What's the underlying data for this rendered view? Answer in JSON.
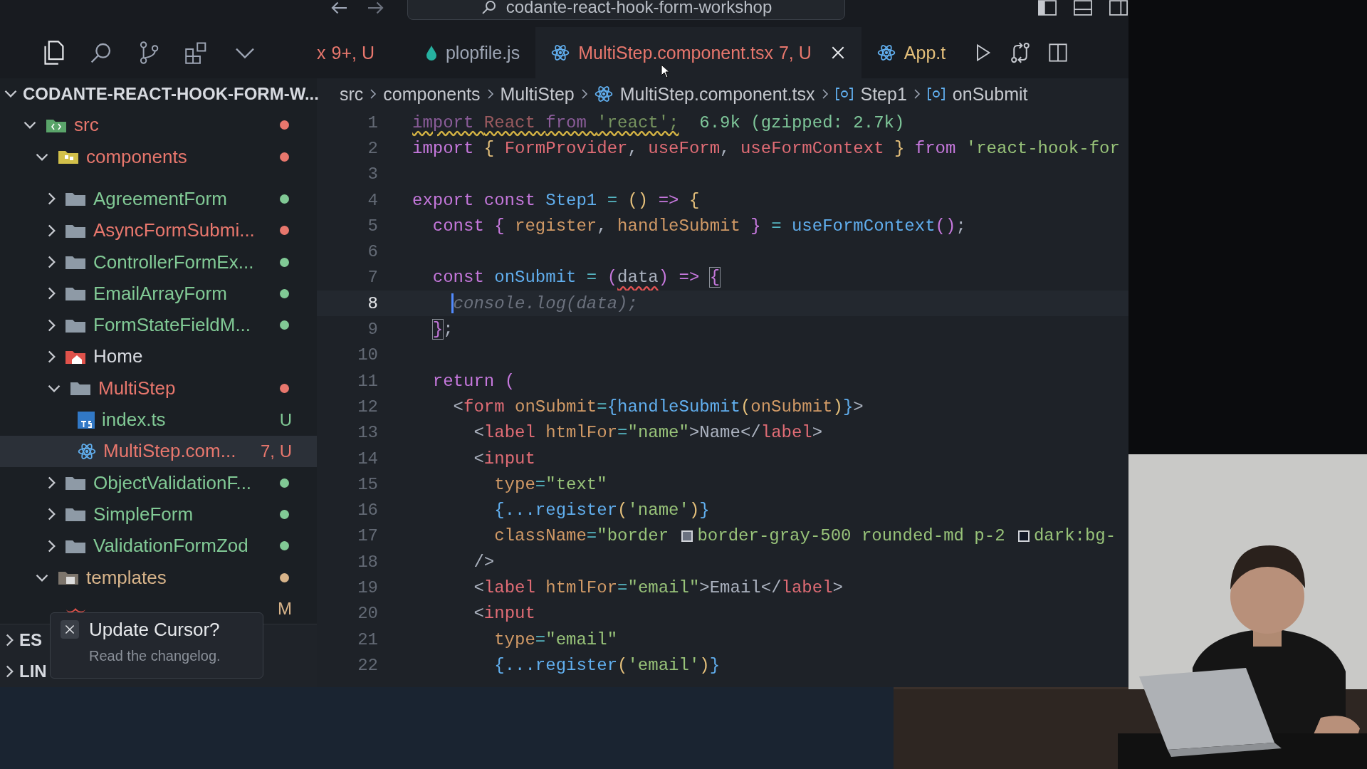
{
  "title_bar": {
    "search": "codante-react-hook-form-workshop"
  },
  "tabs": [
    {
      "label": "x",
      "badge": "9+, U",
      "kind": "plain",
      "selected": false,
      "color": "#e8776d"
    },
    {
      "label": "plopfile.js",
      "kind": "drop",
      "selected": false,
      "color": "#9da5b4"
    },
    {
      "label": "MultiStep.component.tsx",
      "badge": "7, U",
      "kind": "react",
      "selected": true,
      "color": "#e8776d"
    },
    {
      "label": "App.t",
      "kind": "react",
      "selected": false,
      "color": "#e5c07b"
    }
  ],
  "sidebar": {
    "title": "CODANTE-REACT-HOOK-FORM-W...",
    "items": [
      {
        "name": "src",
        "kind": "src-folder",
        "expanded": true,
        "color": "#e8776d",
        "dot": true,
        "selected": false,
        "children": [
          {
            "name": "components",
            "kind": "components-folder",
            "expanded": true,
            "color": "#e8776d",
            "dot": true,
            "selected": false,
            "children": [
              {
                "name": "AgreementForm",
                "kind": "folder",
                "expanded": false,
                "color": "#81c995",
                "dot": true,
                "selected": false
              },
              {
                "name": "AsyncFormSubmi...",
                "kind": "folder",
                "expanded": false,
                "color": "#e8776d",
                "dot": true,
                "selected": false
              },
              {
                "name": "ControllerFormEx...",
                "kind": "folder",
                "expanded": false,
                "color": "#81c995",
                "dot": true,
                "selected": false
              },
              {
                "name": "EmailArrayForm",
                "kind": "folder",
                "expanded": false,
                "color": "#81c995",
                "dot": true,
                "selected": false
              },
              {
                "name": "FormStateFieldM...",
                "kind": "folder",
                "expanded": false,
                "color": "#81c995",
                "dot": true,
                "selected": false
              },
              {
                "name": "Home",
                "kind": "home-folder",
                "expanded": false,
                "color": "#d7dae0",
                "dot": false,
                "selected": false
              },
              {
                "name": "MultiStep",
                "kind": "folder",
                "expanded": true,
                "color": "#e8776d",
                "dot": true,
                "selected": false,
                "children": [
                  {
                    "name": "index.ts",
                    "kind": "ts-file",
                    "color": "#81c995",
                    "badge": "U",
                    "dot": false,
                    "selected": false
                  },
                  {
                    "name": "MultiStep.com...",
                    "kind": "react-file",
                    "color": "#e8776d",
                    "badge": "7, U",
                    "dot": false,
                    "selected": true
                  }
                ]
              },
              {
                "name": "ObjectValidationF...",
                "kind": "folder",
                "expanded": false,
                "color": "#81c995",
                "dot": true,
                "selected": false
              },
              {
                "name": "SimpleForm",
                "kind": "folder",
                "expanded": false,
                "color": "#81c995",
                "dot": true,
                "selected": false
              },
              {
                "name": "ValidationFormZod",
                "kind": "folder",
                "expanded": false,
                "color": "#81c995",
                "dot": true,
                "selected": false
              }
            ]
          },
          {
            "name": "templates",
            "kind": "templates-folder",
            "expanded": true,
            "color": "#d8b48a",
            "dot": true,
            "selected": false,
            "children": [
              {
                "kind": "hbs-file",
                "color": "#d8b48a",
                "badge": "M",
                "dot": false,
                "selected": false
              }
            ]
          }
        ]
      }
    ],
    "sections": [
      {
        "label": "ES"
      },
      {
        "label": "LIN"
      }
    ]
  },
  "notification": {
    "title": "Update Cursor?",
    "body": "Read the changelog."
  },
  "breadcrumb": [
    {
      "label": "src",
      "kind": "folder"
    },
    {
      "label": "components",
      "kind": "folder"
    },
    {
      "label": "MultiStep",
      "kind": "folder"
    },
    {
      "label": "MultiStep.component.tsx",
      "kind": "react"
    },
    {
      "label": "Step1",
      "kind": "symbol"
    },
    {
      "label": "onSubmit",
      "kind": "symbol"
    }
  ],
  "code": [
    {
      "n": "1",
      "current": false,
      "tokens": [
        {
          "text": "import ",
          "kind": "kw-dim",
          "warning": true
        },
        {
          "text": "React ",
          "kind": "id-dim",
          "warning": true
        },
        {
          "text": "from ",
          "kind": "kw-dim",
          "warning": true
        },
        {
          "text": "'react';",
          "kind": "str-dim",
          "warning": true
        },
        {
          "text": "  6.9k (gzipped: 2.7k)",
          "kind": "hint"
        }
      ]
    },
    {
      "n": "2",
      "current": false,
      "tokens": [
        {
          "text": "import ",
          "kind": "kw"
        },
        {
          "text": "{",
          "kind": "br1"
        },
        {
          "text": " FormProvider",
          "kind": "id"
        },
        {
          "text": ", ",
          "kind": "p"
        },
        {
          "text": "useForm",
          "kind": "id"
        },
        {
          "text": ", ",
          "kind": "p"
        },
        {
          "text": "useFormContext",
          "kind": "id"
        },
        {
          "text": " }",
          "kind": "br1"
        },
        {
          "text": " from ",
          "kind": "kw"
        },
        {
          "text": "'react-hook-for",
          "kind": "str"
        }
      ]
    },
    {
      "n": "3",
      "current": false
    },
    {
      "n": "4",
      "current": false,
      "tokens": [
        {
          "text": "export const ",
          "kind": "kw"
        },
        {
          "text": "Step1",
          "kind": "fn"
        },
        {
          "text": " = ",
          "kind": "op"
        },
        {
          "text": "()",
          "kind": "br1"
        },
        {
          "text": " => ",
          "kind": "kw"
        },
        {
          "text": "{",
          "kind": "br1"
        }
      ]
    },
    {
      "n": "5",
      "current": false,
      "tokens": [
        {
          "text": "  const ",
          "kind": "kw"
        },
        {
          "text": "{ ",
          "kind": "br2"
        },
        {
          "text": "register",
          "kind": "attr"
        },
        {
          "text": ", ",
          "kind": "p"
        },
        {
          "text": "handleSubmit",
          "kind": "attr"
        },
        {
          "text": " }",
          "kind": "br2"
        },
        {
          "text": " = ",
          "kind": "op"
        },
        {
          "text": "useFormContext",
          "kind": "fn"
        },
        {
          "text": "()",
          "kind": "br2"
        },
        {
          "text": ";",
          "kind": "p"
        }
      ]
    },
    {
      "n": "6",
      "current": false
    },
    {
      "n": "7",
      "current": false,
      "tokens": [
        {
          "text": "  const ",
          "kind": "kw"
        },
        {
          "text": "onSubmit",
          "kind": "fn"
        },
        {
          "text": " = ",
          "kind": "op"
        },
        {
          "text": "(",
          "kind": "br2"
        },
        {
          "text": "data",
          "kind": "p",
          "error": true
        },
        {
          "text": ")",
          "kind": "br2"
        },
        {
          "text": " => ",
          "kind": "kw"
        },
        {
          "text": "{",
          "kind": "match"
        }
      ]
    },
    {
      "n": "8",
      "current": true,
      "tokens": [
        {
          "text": "    console.log(data);",
          "kind": "ghost"
        }
      ]
    },
    {
      "n": "9",
      "current": false,
      "tokens": [
        {
          "text": "  }",
          "kind": "match"
        },
        {
          "text": ";",
          "kind": "p"
        }
      ]
    },
    {
      "n": "10",
      "current": false
    },
    {
      "n": "11",
      "current": false,
      "tokens": [
        {
          "text": "  return ",
          "kind": "kw"
        },
        {
          "text": "(",
          "kind": "br2"
        }
      ]
    },
    {
      "n": "12",
      "current": false,
      "tokens": [
        {
          "text": "    <",
          "kind": "p"
        },
        {
          "text": "form",
          "kind": "tag"
        },
        {
          "text": " onSubmit",
          "kind": "attr"
        },
        {
          "text": "=",
          "kind": "op"
        },
        {
          "text": "{",
          "kind": "br3"
        },
        {
          "text": "handleSubmit",
          "kind": "fn"
        },
        {
          "text": "(",
          "kind": "br1"
        },
        {
          "text": "onSubmit",
          "kind": "attr"
        },
        {
          "text": ")",
          "kind": "br1"
        },
        {
          "text": "}",
          "kind": "br3"
        },
        {
          "text": ">",
          "kind": "p"
        }
      ]
    },
    {
      "n": "13",
      "current": false,
      "tokens": [
        {
          "text": "      <",
          "kind": "p"
        },
        {
          "text": "label",
          "kind": "tag"
        },
        {
          "text": " htmlFor",
          "kind": "attr"
        },
        {
          "text": "=",
          "kind": "op"
        },
        {
          "text": "\"name\"",
          "kind": "str"
        },
        {
          "text": ">Name</",
          "kind": "p"
        },
        {
          "text": "label",
          "kind": "tag"
        },
        {
          "text": ">",
          "kind": "p"
        }
      ]
    },
    {
      "n": "14",
      "current": false,
      "tokens": [
        {
          "text": "      <",
          "kind": "p"
        },
        {
          "text": "input",
          "kind": "tag"
        }
      ]
    },
    {
      "n": "15",
      "current": false,
      "tokens": [
        {
          "text": "        type",
          "kind": "attr"
        },
        {
          "text": "=",
          "kind": "op"
        },
        {
          "text": "\"text\"",
          "kind": "str"
        }
      ]
    },
    {
      "n": "16",
      "current": false,
      "tokens": [
        {
          "text": "        {",
          "kind": "br3"
        },
        {
          "text": "...register",
          "kind": "fn"
        },
        {
          "text": "(",
          "kind": "br1"
        },
        {
          "text": "'name'",
          "kind": "str"
        },
        {
          "text": ")",
          "kind": "br1"
        },
        {
          "text": "}",
          "kind": "br3"
        }
      ]
    },
    {
      "n": "17",
      "current": false,
      "tokens": [
        {
          "text": "        className",
          "kind": "attr"
        },
        {
          "text": "=",
          "kind": "op"
        },
        {
          "text": "\"border ",
          "kind": "str"
        },
        {
          "kind": "swatch",
          "color": "#6b7280"
        },
        {
          "text": "border-gray-500 rounded-md p-2 ",
          "kind": "str"
        },
        {
          "kind": "swatch",
          "color": "#111827"
        },
        {
          "text": "dark:bg-",
          "kind": "str"
        }
      ]
    },
    {
      "n": "18",
      "current": false,
      "tokens": [
        {
          "text": "      />",
          "kind": "p"
        }
      ]
    },
    {
      "n": "19",
      "current": false,
      "tokens": [
        {
          "text": "      <",
          "kind": "p"
        },
        {
          "text": "label",
          "kind": "tag"
        },
        {
          "text": " htmlFor",
          "kind": "attr"
        },
        {
          "text": "=",
          "kind": "op"
        },
        {
          "text": "\"email\"",
          "kind": "str"
        },
        {
          "text": ">Email</",
          "kind": "p"
        },
        {
          "text": "label",
          "kind": "tag"
        },
        {
          "text": ">",
          "kind": "p"
        }
      ]
    },
    {
      "n": "20",
      "current": false,
      "tokens": [
        {
          "text": "      <",
          "kind": "p"
        },
        {
          "text": "input",
          "kind": "tag"
        }
      ]
    },
    {
      "n": "21",
      "current": false,
      "tokens": [
        {
          "text": "        type",
          "kind": "attr"
        },
        {
          "text": "=",
          "kind": "op"
        },
        {
          "text": "\"email\"",
          "kind": "str"
        }
      ]
    },
    {
      "n": "22",
      "current": false,
      "tokens": [
        {
          "text": "        {",
          "kind": "br3"
        },
        {
          "text": "...register",
          "kind": "fn"
        },
        {
          "text": "(",
          "kind": "br1"
        },
        {
          "text": "'email'",
          "kind": "str"
        },
        {
          "text": ")",
          "kind": "br1"
        },
        {
          "text": "}",
          "kind": "br3"
        }
      ]
    }
  ]
}
